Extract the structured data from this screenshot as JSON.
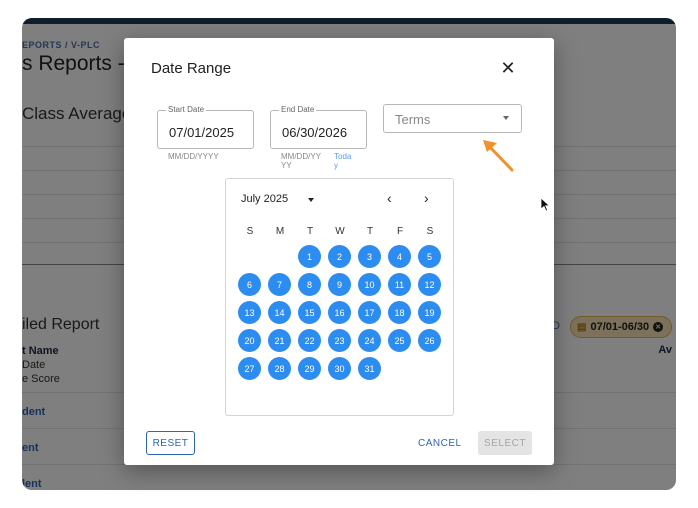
{
  "background": {
    "breadcrumb": "EPORTS / V-PLC",
    "page_title": "s Reports - ",
    "section_class_averages": "Class Averages",
    "section_detailed_report": "iled Report",
    "filter_chip_prefix": "D",
    "filter_chip_text": "07/01-06/30",
    "table_headers": {
      "name": "t Name",
      "date": "Date",
      "score": "e Score",
      "average": "Av"
    },
    "student_rows": [
      "dent",
      "ent",
      "lent"
    ]
  },
  "dialog": {
    "title": "Date Range",
    "close_glyph": "✕",
    "start_date": {
      "label": "Start Date",
      "value": "07/01/2025",
      "hint": "MM/DD/YYYY"
    },
    "end_date": {
      "label": "End Date",
      "value": "06/30/2026",
      "hint_line1": "MM/DD/YY",
      "hint_line2": "YY",
      "today_line1": "Toda",
      "today_line2": "y"
    },
    "terms_select": {
      "placeholder": "Terms"
    },
    "calendar": {
      "month_label": "July 2025",
      "prev_glyph": "‹",
      "next_glyph": "›",
      "weekdays": [
        "S",
        "M",
        "T",
        "W",
        "T",
        "F",
        "S"
      ],
      "first_weekday_index": 2,
      "days": [
        "1",
        "2",
        "3",
        "4",
        "5",
        "6",
        "7",
        "8",
        "9",
        "10",
        "11",
        "12",
        "13",
        "14",
        "15",
        "16",
        "17",
        "18",
        "19",
        "20",
        "21",
        "22",
        "23",
        "24",
        "25",
        "26",
        "27",
        "28",
        "29",
        "30",
        "31"
      ],
      "selected_color": "#2d8cf0"
    },
    "buttons": {
      "reset": "RESET",
      "cancel": "CANCEL",
      "select": "SELECT"
    }
  },
  "annotation": {
    "arrow_color": "#f2912c"
  }
}
